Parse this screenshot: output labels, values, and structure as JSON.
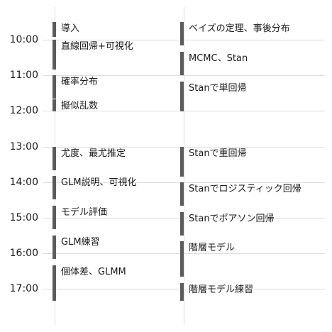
{
  "colors": {
    "bar": "#5c5c5c",
    "grid": "#dddddd",
    "text": "#1a1a1a"
  },
  "time_labels": [
    "10:00",
    "11:00",
    "12:00",
    "13:00",
    "14:00",
    "15:00",
    "16:00",
    "17:00"
  ],
  "columns": [
    {
      "blocks": [
        {
          "label": "導入",
          "start": "09:30",
          "end": "09:55"
        },
        {
          "label": "直線回帰+可視化",
          "start": "10:00",
          "end": "10:50"
        },
        {
          "label": "確率分布",
          "start": "11:00",
          "end": "11:40"
        },
        {
          "label": "擬似乱数",
          "start": "11:40",
          "end": "12:00"
        },
        {
          "label": "尤度、最尤推定",
          "start": "13:00",
          "end": "13:40"
        },
        {
          "label": "GLM説明、可視化",
          "start": "13:50",
          "end": "14:30"
        },
        {
          "label": "モデル評価",
          "start": "14:40",
          "end": "15:20"
        },
        {
          "label": "GLM練習",
          "start": "15:30",
          "end": "16:10"
        },
        {
          "label": "個体差、GLMM",
          "start": "16:20",
          "end": "17:20"
        }
      ]
    },
    {
      "blocks": [
        {
          "label": "ベイズの定理、事後分布",
          "start": "09:30",
          "end": "10:10"
        },
        {
          "label": "MCMC、Stan",
          "start": "10:20",
          "end": "11:00"
        },
        {
          "label": "Stanで単回帰",
          "start": "11:10",
          "end": "12:00"
        },
        {
          "label": "Stanで重回帰",
          "start": "13:00",
          "end": "13:50"
        },
        {
          "label": "Stanでロジスティック回帰",
          "start": "14:00",
          "end": "14:40"
        },
        {
          "label": "Stanでポアソン回帰",
          "start": "14:50",
          "end": "15:30"
        },
        {
          "label": "階層モデル",
          "start": "15:40",
          "end": "16:40"
        },
        {
          "label": "階層モデル練習",
          "start": "16:50",
          "end": "17:20"
        }
      ]
    }
  ]
}
